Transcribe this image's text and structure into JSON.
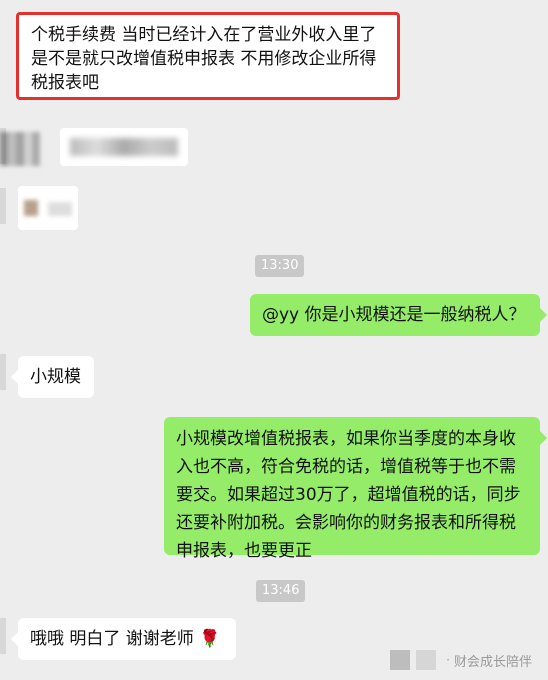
{
  "messages": {
    "top_highlight": "个税手续费  当时已经计入在了营业外收入里了  是不是就只改增值税申报表  不用修改企业所得税报表吧",
    "time_1": "13:30",
    "out_1": "@yy 你是小规模还是一般纳税人？",
    "in_1": "小规模",
    "out_2": "小规模改增值税报表，如果你当季度的本身收入也不高，符合免税的话，增值税等于也不需要交。如果超过30万了，超增值税的话，同步还要补附加税。会影响你的财务报表和所得税申报表，也要更正",
    "time_2": "13:46",
    "in_2": "哦哦 明白了 谢谢老师",
    "rose_emoji": "🌹"
  },
  "footer": {
    "brand": "财会成长陪伴"
  },
  "icons": {
    "rose": "rose-icon"
  },
  "colors": {
    "background": "#ededed",
    "incoming_bubble": "#ffffff",
    "outgoing_bubble": "#95ec69",
    "highlight_border": "#e5312b",
    "timestamp_bg": "#c8c8c8"
  }
}
